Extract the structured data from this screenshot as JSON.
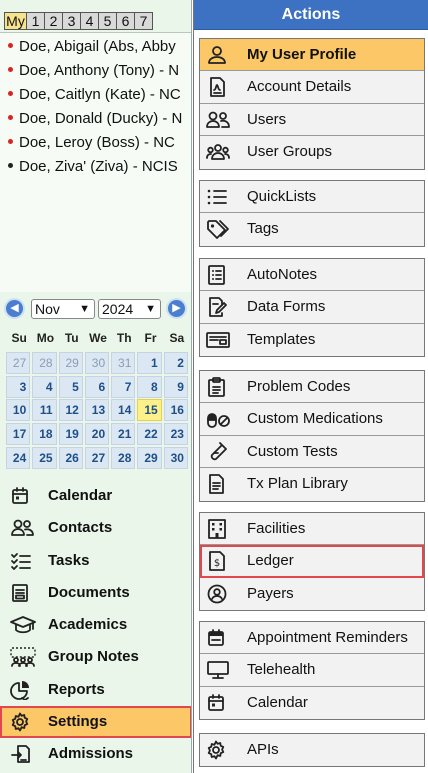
{
  "left": {
    "tabs": [
      "My",
      "1",
      "2",
      "3",
      "4",
      "5",
      "6",
      "7"
    ],
    "patients": [
      {
        "name": "Doe, Abigail (Abs, Abby",
        "dot": "red"
      },
      {
        "name": "Doe, Anthony (Tony) - N",
        "dot": "red"
      },
      {
        "name": "Doe, Caitlyn (Kate) - NC",
        "dot": "red"
      },
      {
        "name": "Doe, Donald (Ducky) - N",
        "dot": "red"
      },
      {
        "name": "Doe, Leroy (Boss) - NC",
        "dot": "red"
      },
      {
        "name": "Doe, Ziva' (Ziva) - NCIS",
        "dot": "dark"
      }
    ],
    "calendar": {
      "month": "Nov",
      "year": "2024",
      "weekdays": [
        "Su",
        "Mo",
        "Tu",
        "We",
        "Th",
        "Fr",
        "Sa"
      ],
      "weeks": [
        [
          "27",
          "28",
          "29",
          "30",
          "31",
          "1",
          "2"
        ],
        [
          "3",
          "4",
          "5",
          "6",
          "7",
          "8",
          "9"
        ],
        [
          "10",
          "11",
          "12",
          "13",
          "14",
          "15",
          "16"
        ],
        [
          "17",
          "18",
          "19",
          "20",
          "21",
          "22",
          "23"
        ],
        [
          "24",
          "25",
          "26",
          "27",
          "28",
          "29",
          "30"
        ]
      ],
      "today": "15"
    },
    "nav": [
      {
        "label": "Calendar",
        "icon": "calendar-icon"
      },
      {
        "label": "Contacts",
        "icon": "contacts-icon"
      },
      {
        "label": "Tasks",
        "icon": "tasks-icon"
      },
      {
        "label": "Documents",
        "icon": "documents-icon"
      },
      {
        "label": "Academics",
        "icon": "graduation-cap-icon"
      },
      {
        "label": "Group Notes",
        "icon": "group-notes-icon"
      },
      {
        "label": "Reports",
        "icon": "pie-chart-icon"
      },
      {
        "label": "Settings",
        "icon": "gear-icon",
        "active": true
      },
      {
        "label": "Admissions",
        "icon": "admissions-icon"
      }
    ]
  },
  "actions": {
    "title": "Actions",
    "groups": [
      [
        {
          "label": "My User Profile",
          "icon": "user-icon",
          "highlight": true
        },
        {
          "label": "Account Details",
          "icon": "account-document-icon"
        },
        {
          "label": "Users",
          "icon": "users-icon"
        },
        {
          "label": "User Groups",
          "icon": "user-groups-icon"
        }
      ],
      [
        {
          "label": "QuickLists",
          "icon": "list-icon"
        },
        {
          "label": "Tags",
          "icon": "tag-icon"
        }
      ],
      [
        {
          "label": "AutoNotes",
          "icon": "notes-list-icon"
        },
        {
          "label": "Data Forms",
          "icon": "form-edit-icon"
        },
        {
          "label": "Templates",
          "icon": "template-icon"
        }
      ],
      [
        {
          "label": "Problem Codes",
          "icon": "clipboard-icon"
        },
        {
          "label": "Custom Medications",
          "icon": "pill-icon"
        },
        {
          "label": "Custom Tests",
          "icon": "test-tube-icon"
        },
        {
          "label": "Tx Plan Library",
          "icon": "document-icon"
        }
      ],
      [
        {
          "label": "Facilities",
          "icon": "building-icon"
        },
        {
          "label": "Ledger",
          "icon": "ledger-icon",
          "boxed": true
        },
        {
          "label": "Payers",
          "icon": "payer-icon"
        }
      ],
      [
        {
          "label": "Appointment Reminders",
          "icon": "calendar-reminder-icon"
        },
        {
          "label": "Telehealth",
          "icon": "monitor-icon"
        },
        {
          "label": "Calendar",
          "icon": "calendar-icon"
        }
      ],
      [
        {
          "label": "APIs",
          "icon": "gear-icon"
        }
      ]
    ]
  }
}
